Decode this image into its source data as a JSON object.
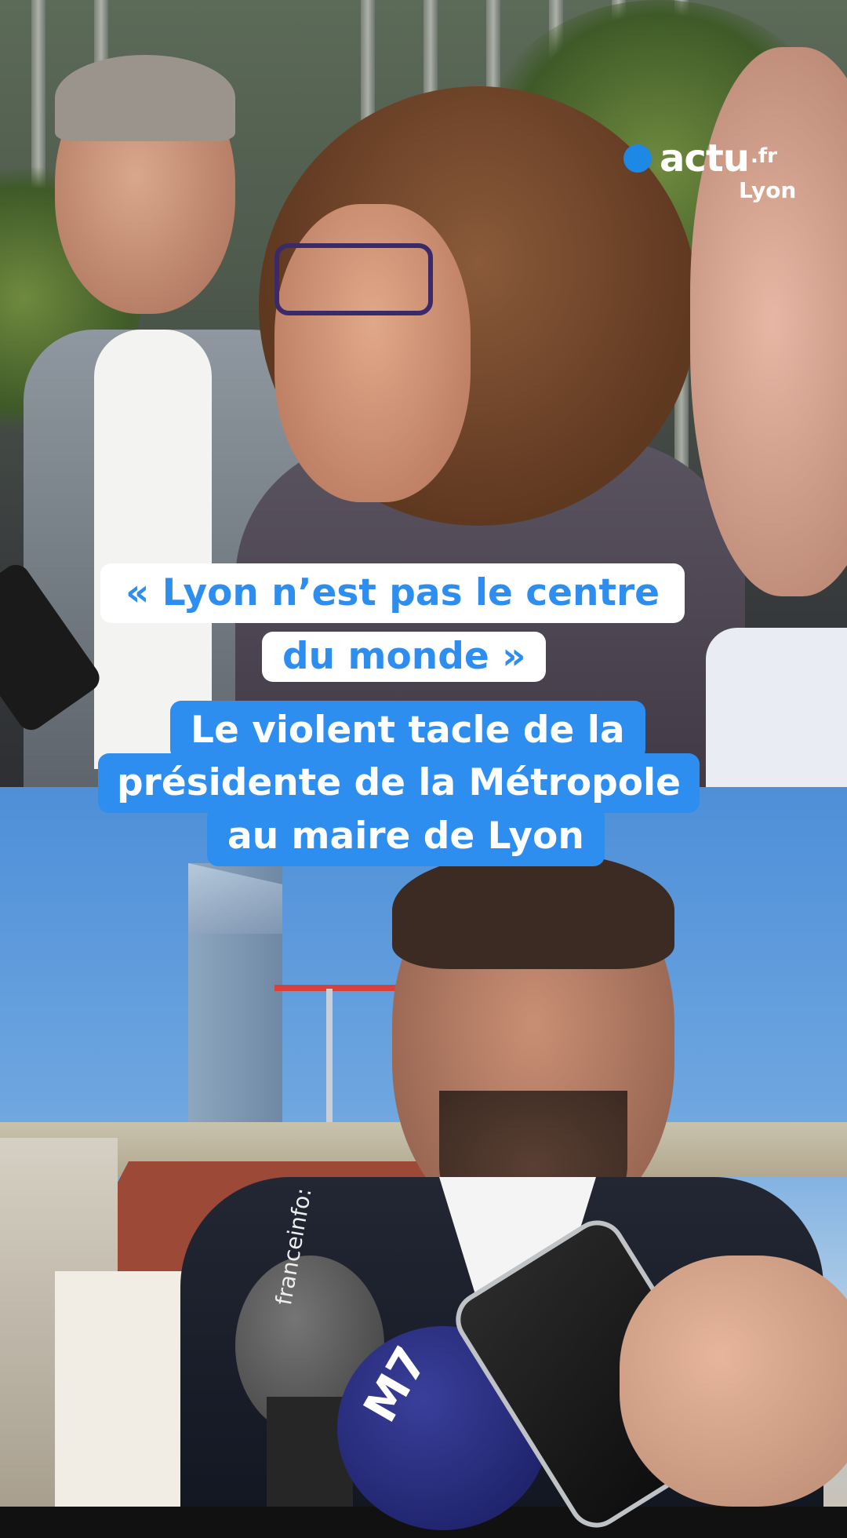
{
  "brand": {
    "logo_text": "actu",
    "logo_tld": ".fr",
    "city": "Lyon",
    "accent_color": "#2e8ef0"
  },
  "headline": {
    "quote_line1": "« Lyon n’est pas le centre",
    "quote_line2": "du monde »",
    "subtitle_line1": "Le violent tacle de la",
    "subtitle_line2": "présidente de la Métropole",
    "subtitle_line3": "au maire de Lyon"
  },
  "microphones": {
    "mic1_label": "franceinfo:",
    "mic2_label": "M7"
  }
}
